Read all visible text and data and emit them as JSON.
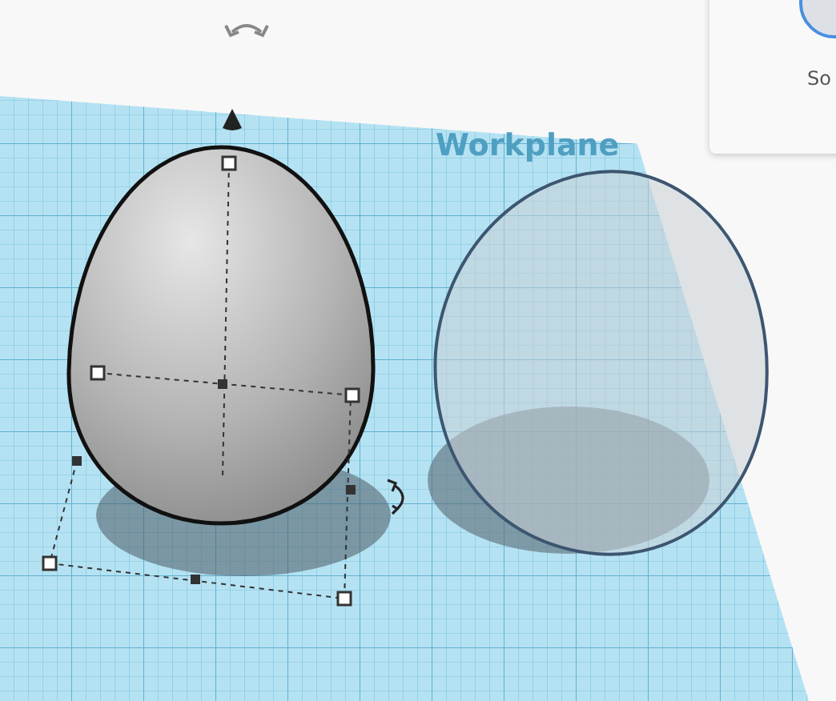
{
  "workplane": {
    "label": "Workplane"
  },
  "panel": {
    "item_label": "So"
  }
}
